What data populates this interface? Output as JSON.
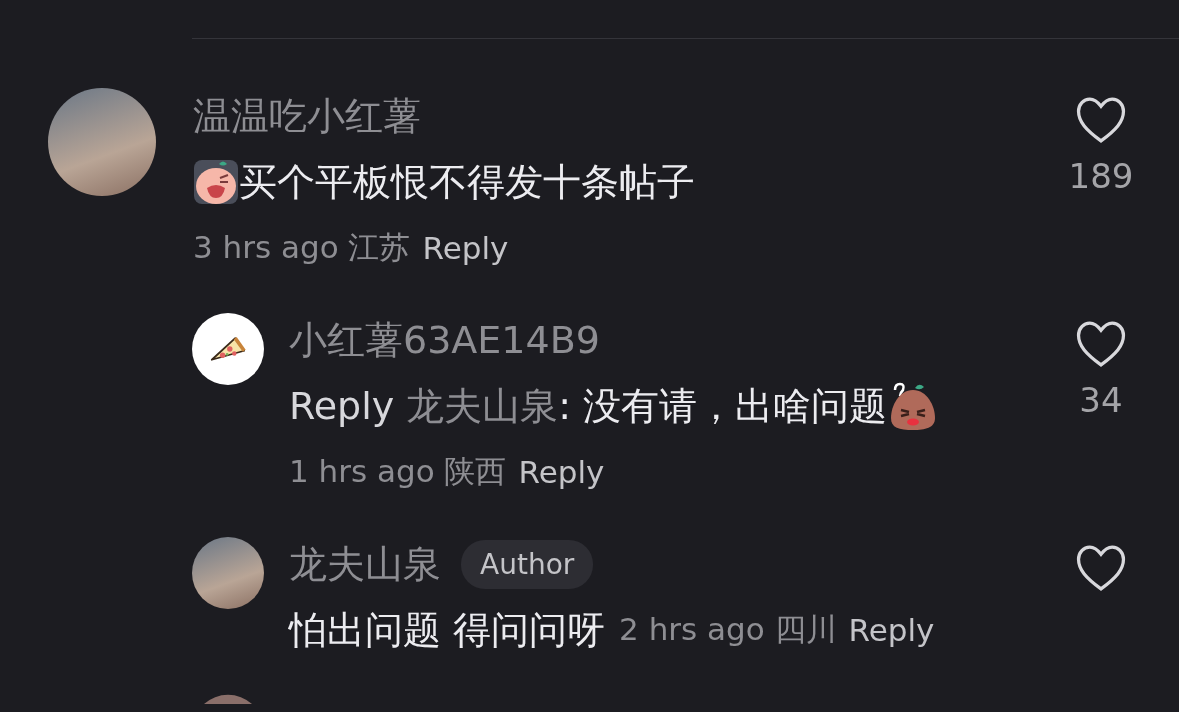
{
  "comments": [
    {
      "kind": "comment",
      "avatar": {
        "kind": "photo"
      },
      "name": "温温吃小红薯",
      "meta_inline": false,
      "content": [
        {
          "kind": "crying_emoji"
        },
        {
          "kind": "text",
          "text": "买个平板恨不得发十条帖子"
        }
      ],
      "time": "3 hrs ago",
      "location": "江苏",
      "reply_label": "Reply",
      "liked": false,
      "likes": "189",
      "children": [
        {
          "kind": "comment",
          "avatar": {
            "kind": "pizza"
          },
          "name": "小红薯63AE14B9",
          "meta_inline": false,
          "content": [
            {
              "kind": "reply_prefix",
              "text": "Reply"
            },
            {
              "kind": "mention",
              "text": "龙夫山泉"
            },
            {
              "kind": "text",
              "text": ": 没有请，出啥问题"
            },
            {
              "kind": "potato_emoji"
            }
          ],
          "time": "1 hrs ago",
          "location": "陕西",
          "reply_label": "Reply",
          "liked": false,
          "likes": "34"
        },
        {
          "kind": "comment",
          "avatar": {
            "kind": "photo"
          },
          "name": "龙夫山泉",
          "badge": "Author",
          "meta_inline": true,
          "content": [
            {
              "kind": "text",
              "text": "怕出问题 得问问呀"
            }
          ],
          "time": "2 hrs ago",
          "location": "四川",
          "reply_label": "Reply",
          "liked": false
        },
        {
          "kind": "avatar_only",
          "avatar": {
            "kind": "photo"
          }
        }
      ]
    }
  ]
}
